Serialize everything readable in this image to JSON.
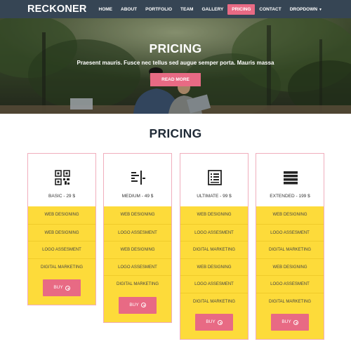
{
  "brand": "RECKONER",
  "nav": {
    "items": [
      {
        "label": "HOME"
      },
      {
        "label": "ABOUT"
      },
      {
        "label": "PORTFOLIO"
      },
      {
        "label": "TEAM"
      },
      {
        "label": "GALLERY"
      },
      {
        "label": "PRICING",
        "active": true
      },
      {
        "label": "CONTACT"
      },
      {
        "label": "DROPDOWN",
        "dropdown": true
      }
    ]
  },
  "hero": {
    "title": "PRICING",
    "subtitle": "Praesent mauris. Fusce nec tellus sed augue semper porta. Mauris massa",
    "button": "READ MORE"
  },
  "section": {
    "title": "PRICING"
  },
  "plans": [
    {
      "name": "BASIC - 29 $",
      "icon": "qr-code-icon",
      "features": [
        "WEB DESIGNING",
        "WEB DESIGNING",
        "LOGO ASSESMENT",
        "DIGITAL MARKETING"
      ],
      "button": "BUY"
    },
    {
      "name": "MEDIUM - 49 $",
      "icon": "align-list-icon",
      "features": [
        "WEB DESIGNING",
        "LOGO ASSESMENT",
        "WEB DESIGNING",
        "LOGO ASSESMENT",
        "DIGITAL MARKETING"
      ],
      "button": "BUY"
    },
    {
      "name": "ULTIMATE - 99 $",
      "icon": "document-list-icon",
      "features": [
        "WEB DESIGNING",
        "LOGO ASSESMENT",
        "DIGITAL MARKETING",
        "WEB DESIGNING",
        "LOGO ASSESMENT",
        "DIGITAL MARKETING"
      ],
      "button": "BUY"
    },
    {
      "name": "EXTENDED - 199 $",
      "icon": "list-bars-icon",
      "features": [
        "WEB DESIGNING",
        "LOGO ASSESMENT",
        "DIGITAL MARKETING",
        "WEB DESIGNING",
        "LOGO ASSESMENT",
        "DIGITAL MARKETING"
      ],
      "button": "BUY"
    }
  ],
  "colors": {
    "navbar": "#364554",
    "accent": "#e86a84",
    "card_body": "#fddb3a",
    "card_border": "#f0aebd",
    "heading": "#1f2a36"
  }
}
